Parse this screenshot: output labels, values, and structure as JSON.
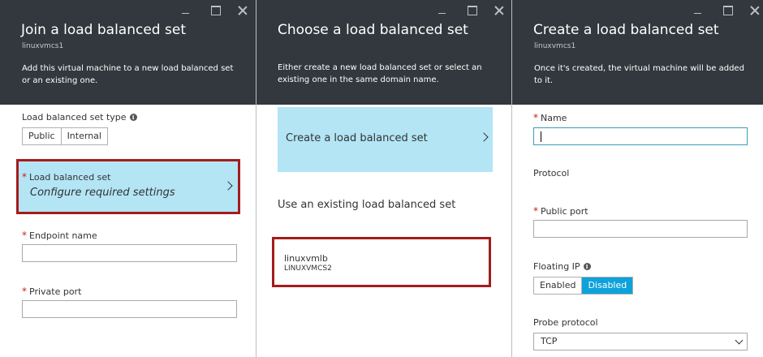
{
  "window_controls": {
    "minimize": "minimize-icon",
    "maximize": "maximize-icon",
    "close": "close-icon"
  },
  "blade1": {
    "title": "Join a load balanced set",
    "subtitle": "linuxvmcs1",
    "description": "Add this virtual machine to a new load balanced set or an existing one.",
    "type_label": "Load balanced set type",
    "type_options": [
      "Public",
      "Internal"
    ],
    "lbset_label": "Load balanced set",
    "lbset_hint": "Configure required settings",
    "endpoint_label": "Endpoint name",
    "endpoint_value": "",
    "private_port_label": "Private port",
    "private_port_value": ""
  },
  "blade2": {
    "title": "Choose a load balanced set",
    "description": "Either create a new load balanced set or select an existing one in the same domain name.",
    "create_label": "Create a load balanced set",
    "existing_heading": "Use an existing load balanced set",
    "existing_items": [
      {
        "name": "linuxvmlb",
        "service": "LINUXVMCS2"
      }
    ]
  },
  "blade3": {
    "title": "Create a load balanced set",
    "subtitle": "linuxvmcs1",
    "description": "Once it's created, the virtual machine will be added to it.",
    "name_label": "Name",
    "name_value": "",
    "protocol_label": "Protocol",
    "public_port_label": "Public port",
    "public_port_value": "",
    "floating_ip_label": "Floating IP",
    "floating_ip_options": [
      "Enabled",
      "Disabled"
    ],
    "floating_ip_selected": "Disabled",
    "probe_protocol_label": "Probe protocol",
    "probe_protocol_value": "TCP"
  },
  "required_marker": "*",
  "info_glyph": "i",
  "colors": {
    "header_bg": "#32383d",
    "card_bg": "#b3e5f5",
    "accent": "#0ea2da",
    "highlight": "#a51c1c",
    "required": "#c81e1e"
  }
}
